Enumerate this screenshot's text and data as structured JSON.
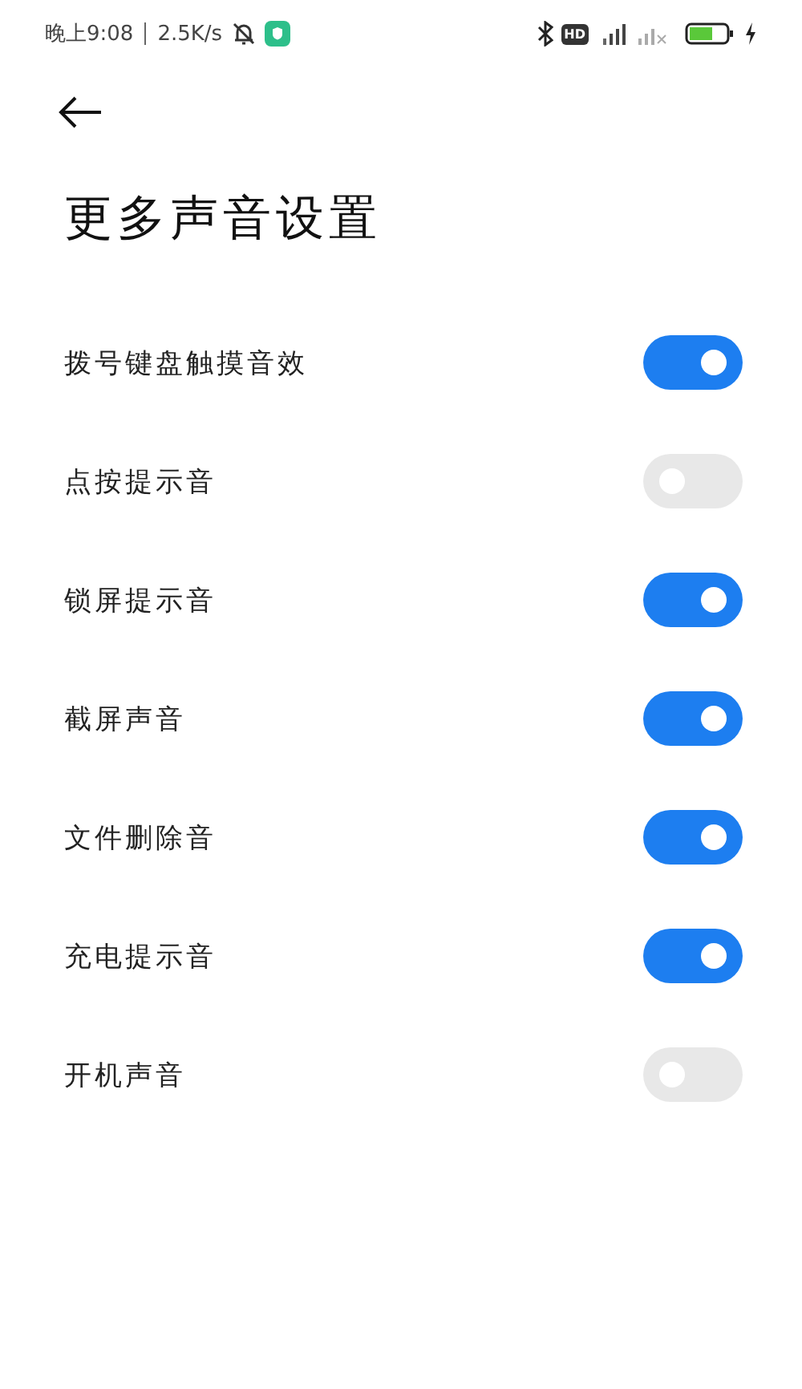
{
  "status_bar": {
    "time": "晚上9:08",
    "speed": "2.5K/s",
    "hd": "HD"
  },
  "title": "更多声音设置",
  "settings": [
    {
      "label": "拨号键盘触摸音效",
      "on": true
    },
    {
      "label": "点按提示音",
      "on": false
    },
    {
      "label": "锁屏提示音",
      "on": true
    },
    {
      "label": "截屏声音",
      "on": true
    },
    {
      "label": "文件删除音",
      "on": true
    },
    {
      "label": "充电提示音",
      "on": true
    },
    {
      "label": "开机声音",
      "on": false
    }
  ]
}
